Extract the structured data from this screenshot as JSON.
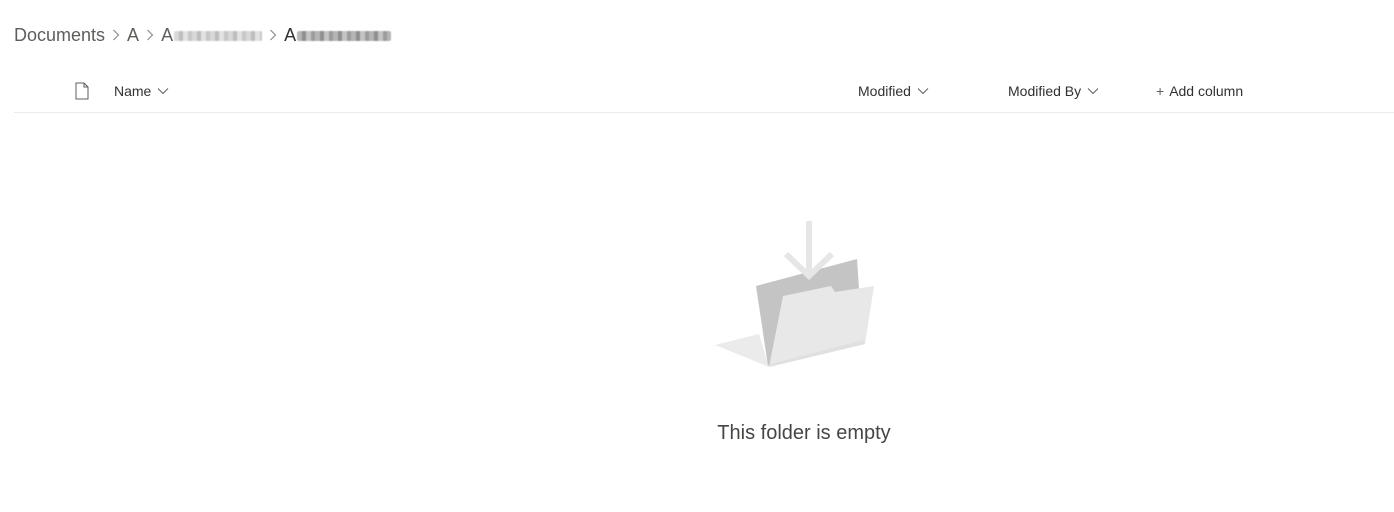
{
  "breadcrumb": {
    "items": [
      {
        "label": "Documents"
      },
      {
        "label": "A"
      },
      {
        "label": "A"
      },
      {
        "label": "A"
      }
    ]
  },
  "columns": {
    "name": "Name",
    "modified": "Modified",
    "modified_by": "Modified By",
    "add_column": "Add column",
    "add_icon": "+"
  },
  "empty_state": {
    "message": "This folder is empty"
  },
  "icons": {
    "file_type": "document-icon",
    "chevron": "chevron-down-icon",
    "separator": "chevron-right-icon",
    "illustration": "empty-folder-illustration"
  },
  "colors": {
    "text": "#323130",
    "muted": "#605e5c",
    "divider": "#edebe9",
    "illustration_light": "#e8e8e8",
    "illustration_dark": "#c4c4c4"
  }
}
